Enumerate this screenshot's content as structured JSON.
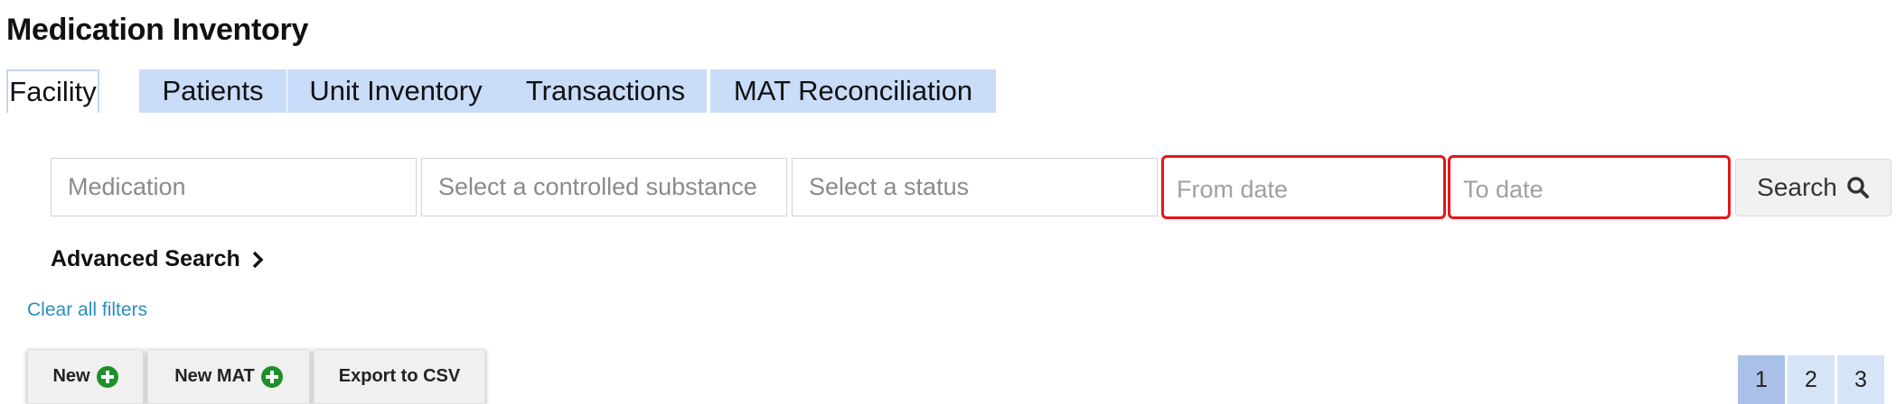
{
  "page": {
    "title": "Medication Inventory"
  },
  "tabs": [
    {
      "label": "Facility",
      "active": true
    },
    {
      "label": "Patients",
      "active": false
    },
    {
      "label": "Unit Inventory",
      "active": false
    },
    {
      "label": "Transactions",
      "active": false
    },
    {
      "label": "MAT Reconciliation",
      "active": false
    }
  ],
  "filters": {
    "medication_placeholder": "Medication",
    "substance_placeholder": "Select a controlled substance",
    "status_placeholder": "Select a status",
    "from_date_placeholder": "From date",
    "to_date_placeholder": "To date",
    "search_label": "Search",
    "search_icon": "search-icon"
  },
  "advanced_search": {
    "label": "Advanced Search",
    "icon": "chevron-right-icon"
  },
  "clear_filters": {
    "label": "Clear all filters"
  },
  "toolbar": {
    "new_label": "New",
    "new_mat_label": "New MAT",
    "export_label": "Export to CSV",
    "add_icon": "plus-circle-icon"
  },
  "pagination": {
    "pages": [
      "1",
      "2",
      "3"
    ],
    "current": "1"
  },
  "colors": {
    "tab_bg": "#c9dcf8",
    "highlight_border": "#e8151a",
    "link": "#2a8fc0",
    "add_icon": "#1e8f2a",
    "page_active": "#a9c1e6"
  }
}
